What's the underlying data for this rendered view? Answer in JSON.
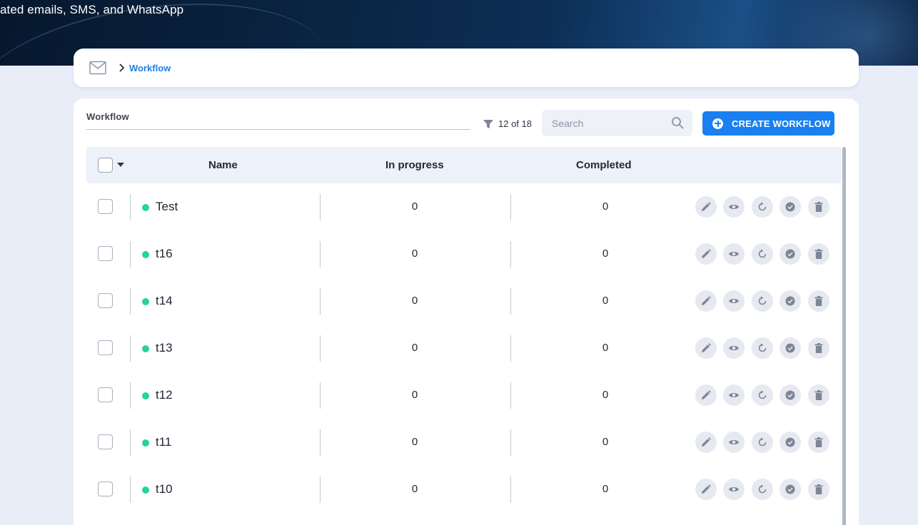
{
  "hero": {
    "text": "ated emails, SMS, and WhatsApp"
  },
  "breadcrumb": {
    "icon": "mail-icon",
    "current": "Workflow"
  },
  "toolbar": {
    "label": "Workflow",
    "filter_count": "12 of 18",
    "search_placeholder": "Search",
    "create_label": "CREATE WORKFLOW"
  },
  "table": {
    "columns": {
      "name": "Name",
      "in_progress": "In progress",
      "completed": "Completed"
    },
    "rows": [
      {
        "name": "Test",
        "in_progress": "0",
        "completed": "0",
        "status": "active"
      },
      {
        "name": "t16",
        "in_progress": "0",
        "completed": "0",
        "status": "active"
      },
      {
        "name": "t14",
        "in_progress": "0",
        "completed": "0",
        "status": "active"
      },
      {
        "name": "t13",
        "in_progress": "0",
        "completed": "0",
        "status": "active"
      },
      {
        "name": "t12",
        "in_progress": "0",
        "completed": "0",
        "status": "active"
      },
      {
        "name": "t11",
        "in_progress": "0",
        "completed": "0",
        "status": "active"
      },
      {
        "name": "t10",
        "in_progress": "0",
        "completed": "0",
        "status": "active"
      }
    ],
    "row_actions": [
      "pencil-icon",
      "eye-icon",
      "reset-icon",
      "check-circle-icon",
      "trash-icon"
    ]
  },
  "colors": {
    "accent": "#1a7ff0",
    "status_active": "#25d39b",
    "hero_bg": "#0a2442"
  }
}
